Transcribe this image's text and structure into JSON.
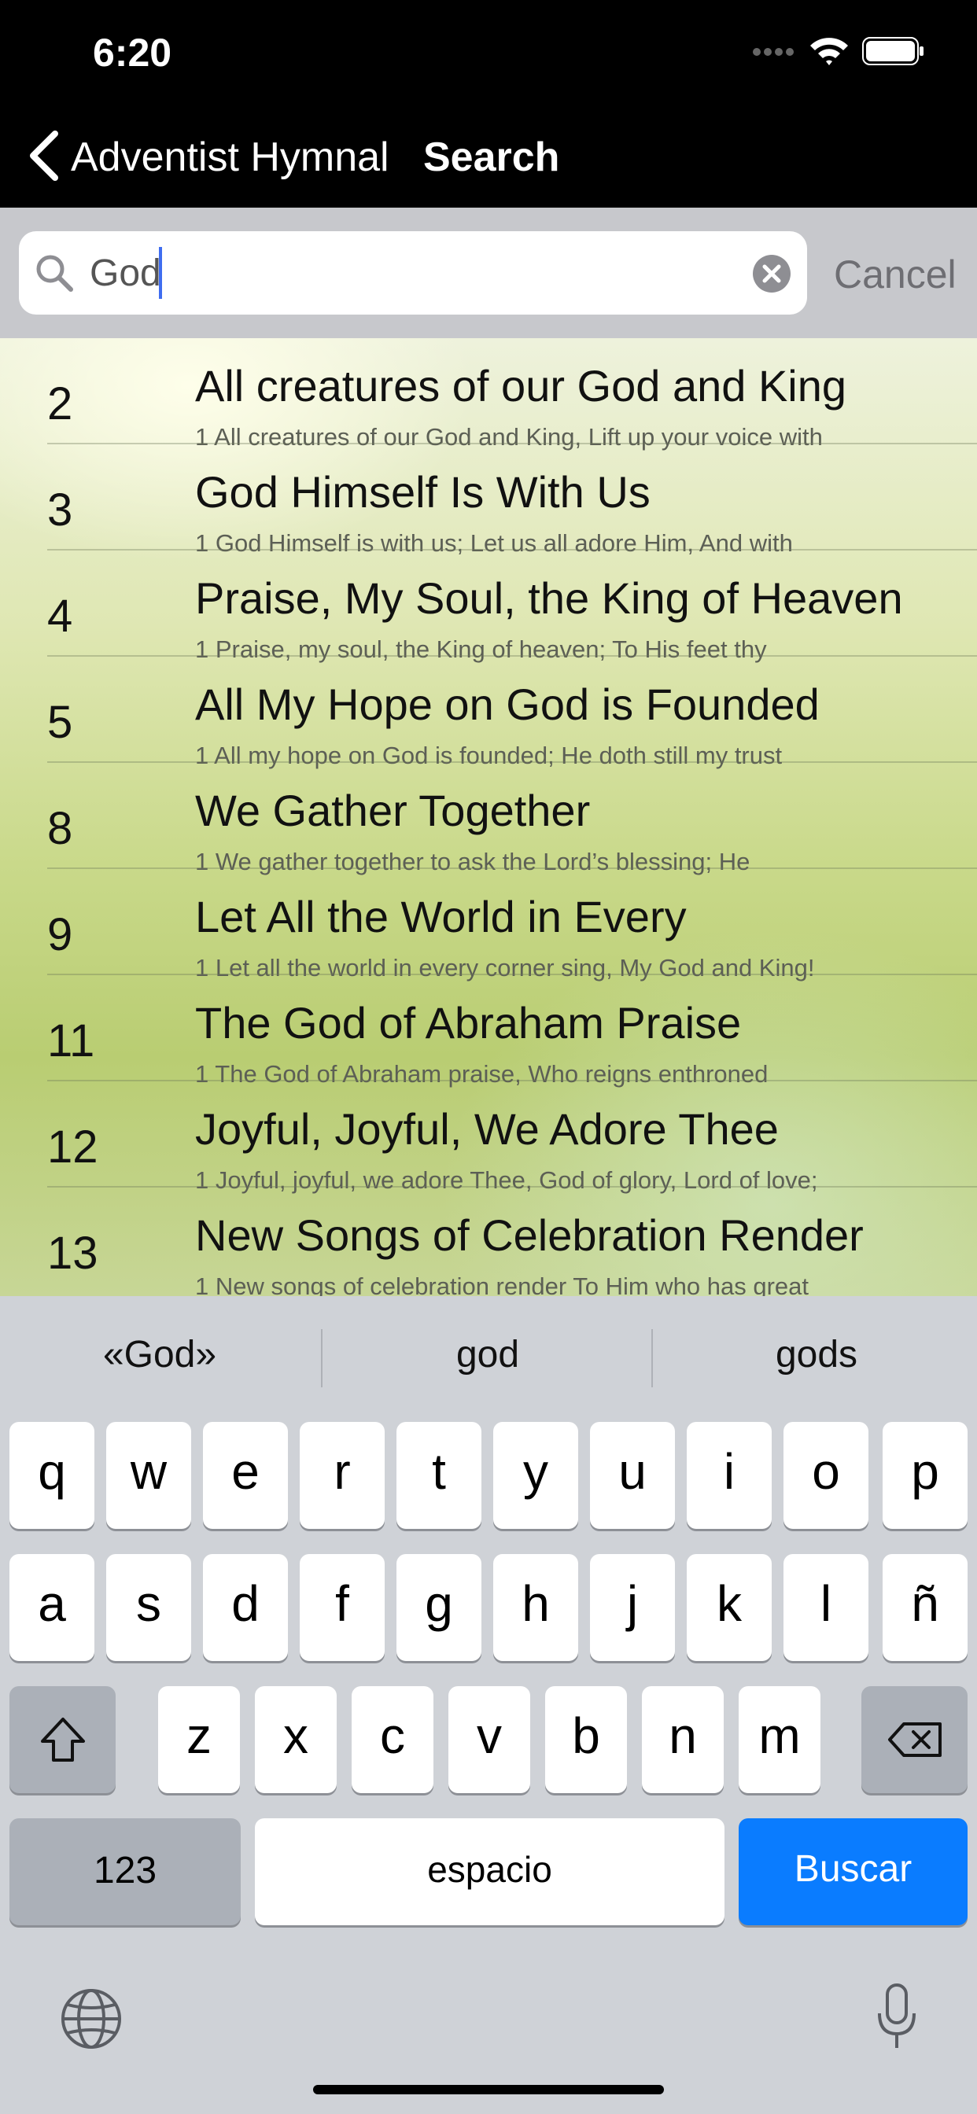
{
  "status_bar": {
    "time": "6:20"
  },
  "nav": {
    "back_label": "Adventist Hymnal",
    "title": "Search"
  },
  "search": {
    "value": "God",
    "cancel_label": "Cancel"
  },
  "results": [
    {
      "number": "2",
      "title": "All creatures of our God and King",
      "first_line": "1 All creatures of our God and King, Lift up your voice with"
    },
    {
      "number": "3",
      "title": "God Himself Is With Us",
      "first_line": "1 God Himself is with us; Let us all adore Him, And with"
    },
    {
      "number": "4",
      "title": "Praise, My Soul, the King of Heaven",
      "first_line": "1 Praise, my soul, the King of heaven; To His feet thy"
    },
    {
      "number": "5",
      "title": "All My Hope on God is Founded",
      "first_line": "1 All my hope on God is founded; He doth still my trust"
    },
    {
      "number": "8",
      "title": "We Gather Together",
      "first_line": "1 We gather together to ask the Lord’s blessing; He"
    },
    {
      "number": "9",
      "title": "Let All the World in Every",
      "first_line": "1 Let all the world in every corner sing, My God and King!"
    },
    {
      "number": "11",
      "title": "The God of Abraham Praise",
      "first_line": "1 The God of Abraham praise, Who reigns enthroned"
    },
    {
      "number": "12",
      "title": "Joyful, Joyful, We Adore Thee",
      "first_line": "1 Joyful, joyful, we adore Thee, God of glory, Lord of love;"
    },
    {
      "number": "13",
      "title": "New Songs of Celebration Render",
      "first_line": "1 New songs of celebration render To Him who has great"
    }
  ],
  "keyboard": {
    "suggestions": [
      "«God»",
      "god",
      "gods"
    ],
    "row1": [
      "q",
      "w",
      "e",
      "r",
      "t",
      "y",
      "u",
      "i",
      "o",
      "p"
    ],
    "row2": [
      "a",
      "s",
      "d",
      "f",
      "g",
      "h",
      "j",
      "k",
      "l",
      "ñ"
    ],
    "row3": [
      "z",
      "x",
      "c",
      "v",
      "b",
      "n",
      "m"
    ],
    "numbers_label": "123",
    "space_label": "espacio",
    "return_label": "Buscar"
  },
  "colors": {
    "accent": "#0a7cff",
    "keyboard_bg": "#cfd2d7"
  },
  "icons": [
    "back-chevron-icon",
    "search-icon",
    "clear-icon",
    "shift-icon",
    "delete-icon",
    "globe-icon",
    "microphone-icon",
    "wifi-icon",
    "battery-icon",
    "signal-icon"
  ]
}
